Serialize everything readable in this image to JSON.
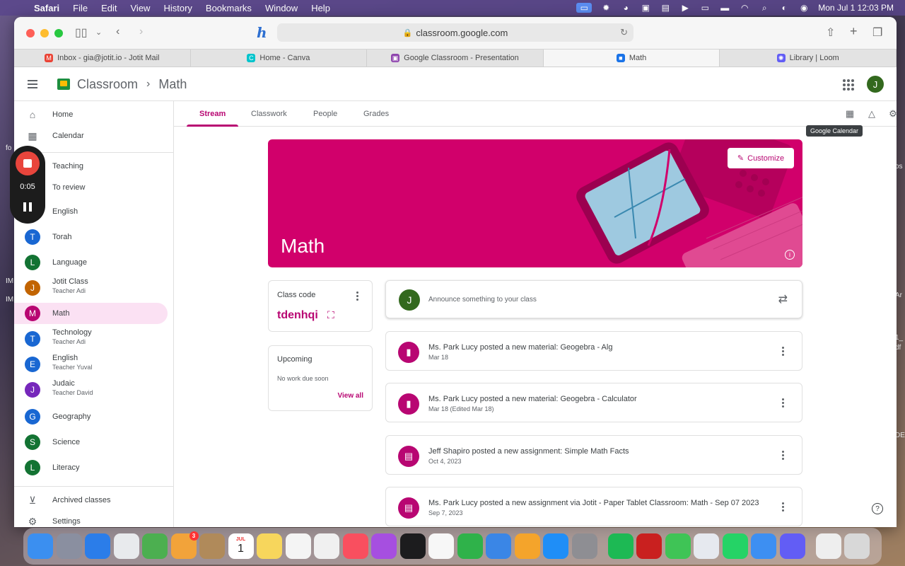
{
  "menubar": {
    "app": "Safari",
    "items": [
      "File",
      "Edit",
      "View",
      "History",
      "Bookmarks",
      "Window",
      "Help"
    ],
    "clock": "Mon Jul 1  12:03 PM"
  },
  "browser": {
    "url": "classroom.google.com",
    "tabs": [
      {
        "label": "Inbox - gia@jotit.io - Jotit Mail",
        "color": "#ea4335",
        "glyph": "M"
      },
      {
        "label": "Home - Canva",
        "color": "#00c4cc",
        "glyph": "C"
      },
      {
        "label": "Google Classroom - Presentation",
        "color": "#8e44ad",
        "glyph": "▣"
      },
      {
        "label": "Math",
        "color": "#1a73e8",
        "glyph": "■"
      },
      {
        "label": "Library | Loom",
        "color": "#625df5",
        "glyph": "✺"
      }
    ]
  },
  "header": {
    "app_title": "Classroom",
    "class_name": "Math",
    "avatar": "J"
  },
  "sidebar": {
    "top": [
      {
        "label": "Home",
        "icon": "⌂"
      },
      {
        "label": "Calendar",
        "icon": "▦"
      }
    ],
    "teaching": [
      {
        "label": "Teaching"
      },
      {
        "label": "To review"
      },
      {
        "label": "English"
      }
    ],
    "classes": [
      {
        "label": "Torah",
        "letter": "T",
        "color": "#1967d2",
        "sub": ""
      },
      {
        "label": "Language",
        "letter": "L",
        "color": "#137333",
        "sub": ""
      },
      {
        "label": "Jotit Class",
        "letter": "J",
        "color": "#c26401",
        "sub": "Teacher Adi"
      },
      {
        "label": "Math",
        "letter": "M",
        "color": "#b80672",
        "sub": "",
        "active": true
      },
      {
        "label": "Technology",
        "letter": "T",
        "color": "#1967d2",
        "sub": "Teacher Adi"
      },
      {
        "label": "English",
        "letter": "E",
        "color": "#1967d2",
        "sub": "Teacher Yuval"
      },
      {
        "label": "Judaic",
        "letter": "J",
        "color": "#7627bb",
        "sub": "Teacher David"
      },
      {
        "label": "Geography",
        "letter": "G",
        "color": "#1967d2",
        "sub": ""
      },
      {
        "label": "Science",
        "letter": "S",
        "color": "#137333",
        "sub": ""
      },
      {
        "label": "Literacy",
        "letter": "L",
        "color": "#137333",
        "sub": ""
      }
    ],
    "archived": "Archived classes",
    "settings": "Settings"
  },
  "recorder": {
    "time": "0:05"
  },
  "tabs": {
    "stream": "Stream",
    "classwork": "Classwork",
    "people": "People",
    "grades": "Grades",
    "tooltip": "Google Calendar"
  },
  "banner": {
    "title": "Math",
    "customize": "Customize"
  },
  "class_code": {
    "label": "Class code",
    "code": "tdenhqi"
  },
  "upcoming": {
    "label": "Upcoming",
    "empty": "No work due soon",
    "view_all": "View all"
  },
  "announce": {
    "placeholder": "Announce something to your class",
    "avatar": "J"
  },
  "posts": [
    {
      "title": "Ms. Park Lucy posted a new material: Geogebra - Alg",
      "date": "Mar 18",
      "icon": "▮"
    },
    {
      "title": "Ms. Park Lucy posted a new material: Geogebra - Calculator",
      "date": "Mar 18 (Edited Mar 18)",
      "icon": "▮"
    },
    {
      "title": "Jeff Shapiro posted a new assignment: Simple Math Facts",
      "date": "Oct 4, 2023",
      "icon": "▤"
    },
    {
      "title": "Ms. Park Lucy posted a new assignment via Jotit - Paper Tablet Classroom: Math - Sep 07 2023",
      "date": "Sep 7, 2023",
      "icon": "▤"
    }
  ],
  "dock": {
    "calendar_month": "JUL",
    "calendar_day": "1",
    "photos_badge": "3",
    "apps": [
      {
        "name": "finder",
        "color": "#3b8ff0"
      },
      {
        "name": "launchpad",
        "color": "#8a8fa0"
      },
      {
        "name": "safari",
        "color": "#2b7de9"
      },
      {
        "name": "chrome",
        "color": "#e8eaed"
      },
      {
        "name": "maps",
        "color": "#4caf50"
      },
      {
        "name": "photos",
        "color": "#f2a33a"
      },
      {
        "name": "contacts",
        "color": "#b08a5a"
      },
      {
        "name": "calendar",
        "color": "#ffffff"
      },
      {
        "name": "notes",
        "color": "#f7d65c"
      },
      {
        "name": "reminders",
        "color": "#f4f4f4"
      },
      {
        "name": "freeform",
        "color": "#f0f0f0"
      },
      {
        "name": "music",
        "color": "#f94f5f"
      },
      {
        "name": "podcasts",
        "color": "#a64fe0"
      },
      {
        "name": "tv",
        "color": "#1c1c1e"
      },
      {
        "name": "news",
        "color": "#f7f7f7"
      },
      {
        "name": "numbers",
        "color": "#2fb24a"
      },
      {
        "name": "keynote",
        "color": "#3a86e6"
      },
      {
        "name": "pages",
        "color": "#f4a42b"
      },
      {
        "name": "appstore",
        "color": "#1f8ef7"
      },
      {
        "name": "settings",
        "color": "#8e8e93"
      },
      {
        "name": "spotify",
        "color": "#1db954"
      },
      {
        "name": "acrobat",
        "color": "#c9201f"
      },
      {
        "name": "facetime",
        "color": "#3fc456"
      },
      {
        "name": "zoom-helper",
        "color": "#e6e9ef"
      },
      {
        "name": "whatsapp",
        "color": "#25d366"
      },
      {
        "name": "mail",
        "color": "#3d8ff2"
      },
      {
        "name": "loom",
        "color": "#625df5"
      },
      {
        "name": "preview",
        "color": "#eeeeee"
      },
      {
        "name": "trash",
        "color": "#d8d8d8"
      }
    ]
  }
}
